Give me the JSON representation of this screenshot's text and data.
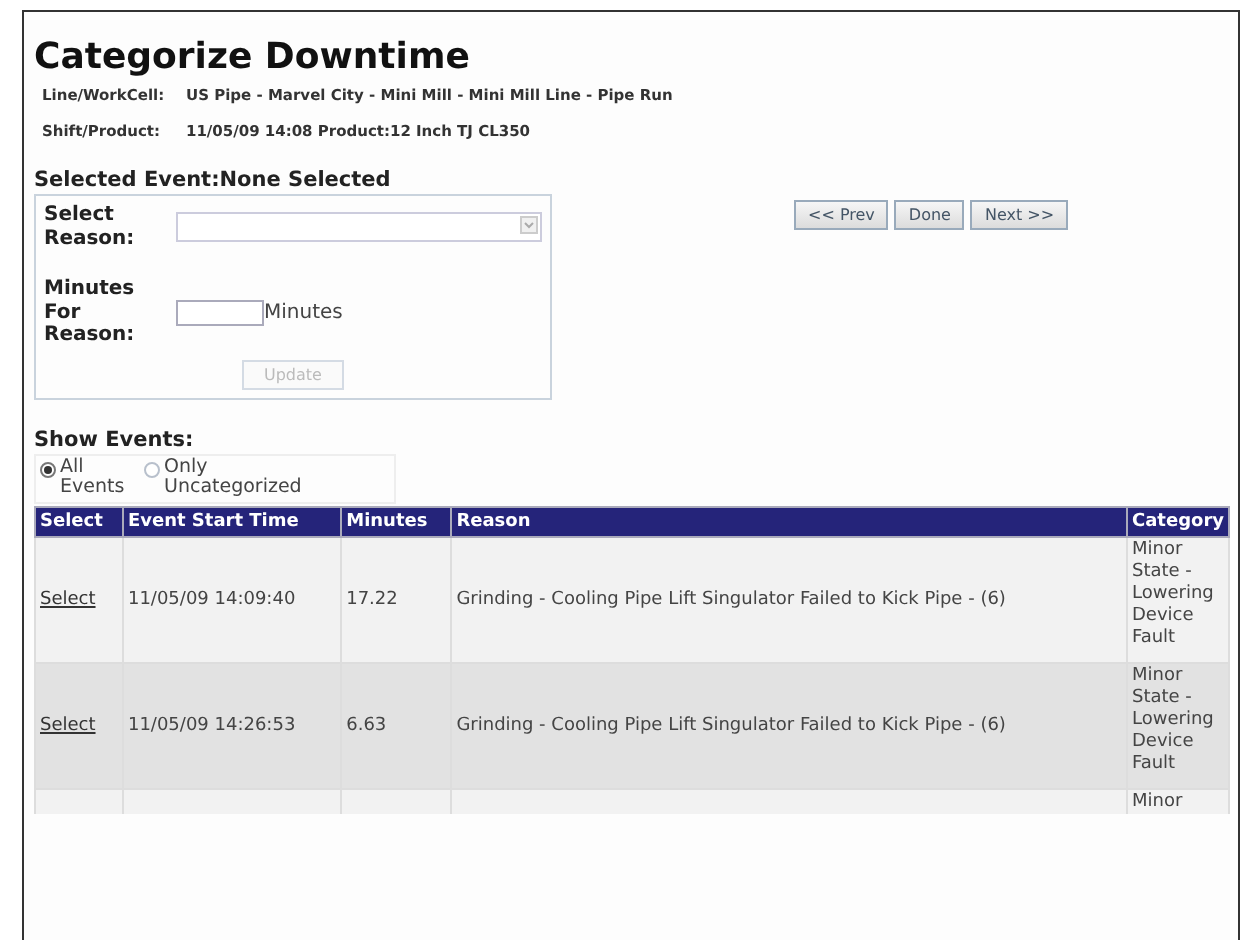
{
  "title": "Categorize Downtime",
  "info": [
    {
      "label": "Line/WorkCell:",
      "value": "US Pipe - Marvel City - Mini Mill - Mini Mill Line - Pipe Run"
    },
    {
      "label": "Shift/Product:",
      "value": "11/05/09 14:08 Product:12 Inch TJ CL350"
    }
  ],
  "selected_event": {
    "heading": "Selected Event:None Selected"
  },
  "reason_form": {
    "select_label": "Select Reason:",
    "minutes_label": "Minutes For Reason:",
    "minutes_unit": "Minutes",
    "update_button": {
      "label": "Update",
      "disabled": true
    }
  },
  "nav_buttons": [
    "<< Prev",
    "Done",
    "Next >>"
  ],
  "show_events": {
    "label": "Show Events:",
    "options": [
      {
        "label": "All Events",
        "selected": true
      },
      {
        "label": "Only Uncategorized",
        "selected": false
      }
    ]
  },
  "table": {
    "columns": [
      "Select",
      "Event Start Time",
      "Minutes",
      "Reason",
      "Category"
    ],
    "rows": [
      {
        "link": "Select",
        "start_time": "11/05/09 14:09:40",
        "minutes": "17.22",
        "reason": "Grinding - Cooling Pipe Lift Singulator Failed to Kick Pipe - (6)",
        "category": "Minor State - Lowering Device Fault"
      },
      {
        "link": "Select",
        "start_time": "11/05/09 14:26:53",
        "minutes": "6.63",
        "reason": "Grinding - Cooling Pipe Lift Singulator Failed to Kick Pipe - (6)",
        "category": "Minor State - Lowering Device Fault"
      },
      {
        "category": "Minor"
      }
    ]
  }
}
